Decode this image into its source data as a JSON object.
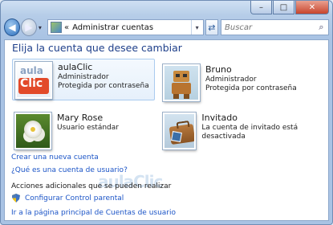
{
  "window": {
    "min_glyph": "–",
    "max_glyph": "□",
    "close_glyph": "✕"
  },
  "nav": {
    "back_glyph": "◀",
    "forward_glyph": "▶",
    "history_glyph": "▾",
    "address_chevron": "«",
    "address": "Administrar cuentas",
    "address_dropdown_glyph": "▾",
    "refresh_glyph": "⇄",
    "search_placeholder": "Buscar",
    "search_glyph": "⌕"
  },
  "main": {
    "title": "Elija la cuenta que desee cambiar",
    "accounts": [
      {
        "name": "aulaClic",
        "line1": "Administrador",
        "line2": "Protegida por contraseña",
        "picture": "aulaclic-logo"
      },
      {
        "name": "Bruno",
        "line1": "Administrador",
        "line2": "Protegida por contraseña",
        "picture": "robot-toy"
      },
      {
        "name": "Mary Rose",
        "line1": "Usuario estándar",
        "line2": "",
        "picture": "flower"
      },
      {
        "name": "Invitado",
        "line1": "La cuenta de invitado está desactivada",
        "line2": "",
        "picture": "briefcase"
      }
    ],
    "picture_text": {
      "aula": "aula",
      "clic": "Clic"
    },
    "links": {
      "create": "Crear una nueva cuenta",
      "what_is": "¿Qué es una cuenta de usuario?",
      "parental": "Configurar Control parental",
      "home": "Ir a la página principal de Cuentas de usuario"
    },
    "section_title": "Acciones adicionales que se pueden realizar",
    "watermark": {
      "aula": "aula",
      "clic": "Clic"
    }
  },
  "colors": {
    "link": "#1c55c7",
    "title": "#1e3f8a",
    "selection": "#e6f0fb"
  }
}
